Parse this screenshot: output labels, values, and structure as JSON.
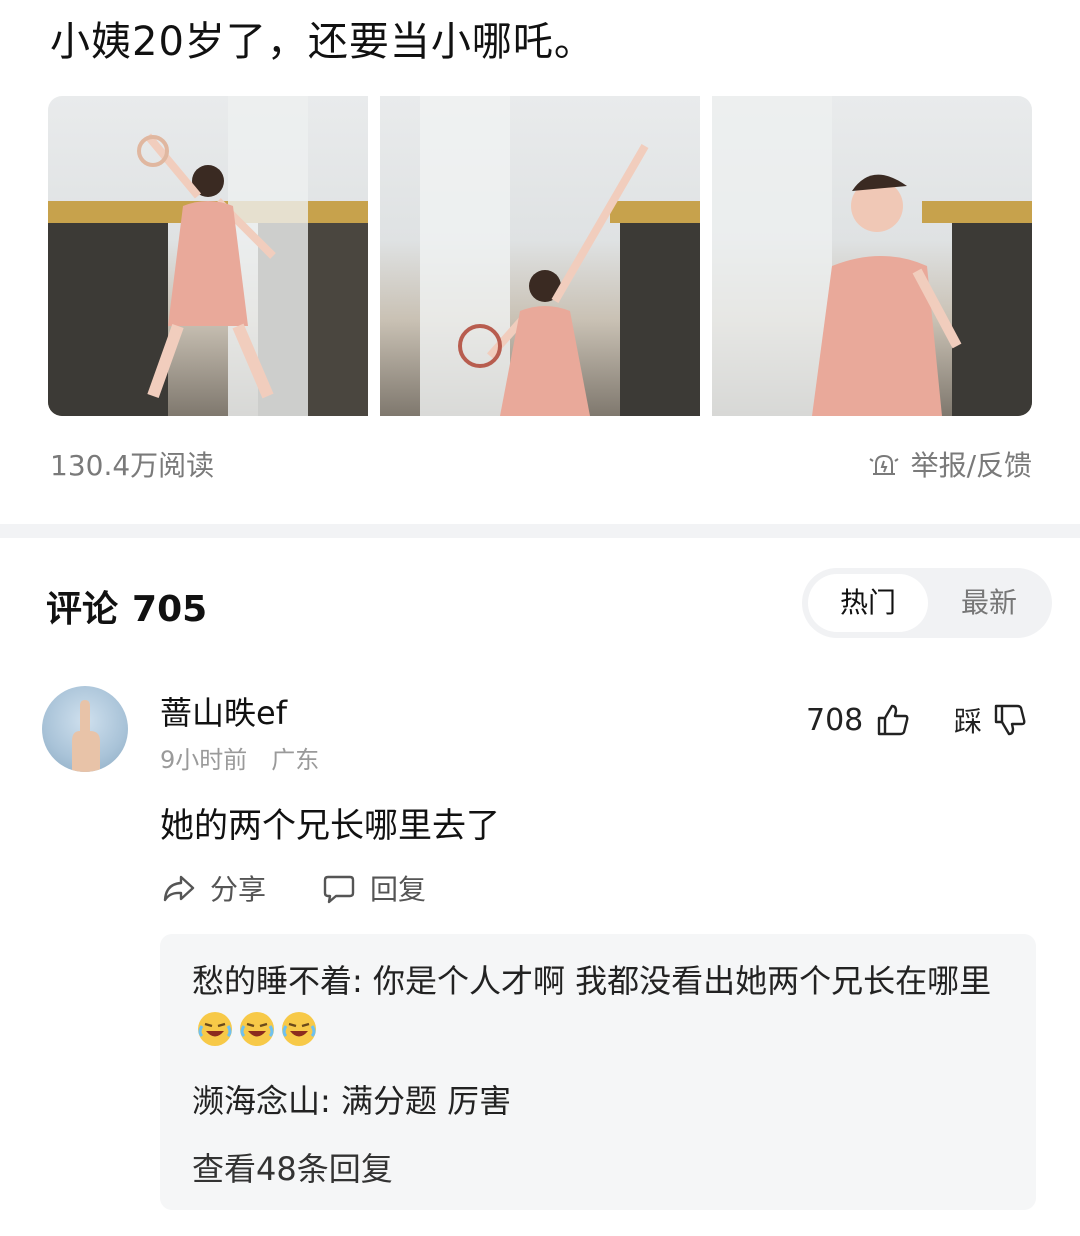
{
  "post": {
    "title": "小姨20岁了，还要当小哪吒。",
    "reads": "130.4万阅读",
    "report_label": "举报/反馈"
  },
  "comments": {
    "title": "评论",
    "count": "705",
    "sort": {
      "hot": "热门",
      "latest": "最新"
    }
  },
  "comment": {
    "username": "蔷山昳ef",
    "time": "9小时前",
    "location": "广东",
    "likes": "708",
    "dislike_label": "踩",
    "text": "她的两个兄长哪里去了",
    "share_label": "分享",
    "reply_label": "回复"
  },
  "replies": [
    {
      "author": "愁的睡不着",
      "text": "你是个人才啊 我都没看出她两个兄长在哪里",
      "emoji_count": 3
    },
    {
      "author": "濒海念山",
      "text": "满分题 厉害"
    }
  ],
  "view_more": "查看48条回复",
  "colors": {
    "muted": "#7a7a7a",
    "divider": "#f2f3f5",
    "reply_bg": "#f5f6f7",
    "dress": "#e9a99a"
  }
}
